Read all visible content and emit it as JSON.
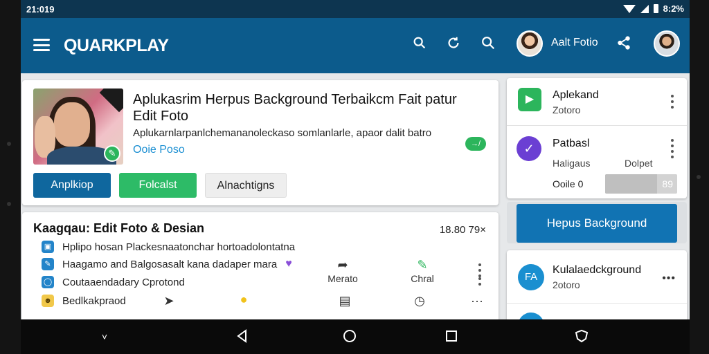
{
  "status_bar": {
    "time": "21:019",
    "battery": "8:2%"
  },
  "app_bar": {
    "title": "QUARKPLAY",
    "user_name": "Aalt Fotio"
  },
  "feature_card": {
    "title": "Aplukasrim Herpus Background Terbaikcm Fait patur Edit Foto",
    "description": "Aplukarnlarpanlchemananoleckaso somlanlarle, apaor dalit batro",
    "link": "Ooie Poso",
    "pill": "→/",
    "buttons": {
      "primary": "Anplkiop",
      "secondary": "Folcalst",
      "tertiary": "Alnachtigns"
    }
  },
  "list_card": {
    "title": "Kaagqau: Edit Foto & Desian",
    "meta": "18.80 79×",
    "rows": [
      {
        "label": "Hplipo hosan Plackesnaatonchar hortoadolontatna"
      },
      {
        "label": "Haagamo and Balgosasalt kana dadaper mara"
      },
      {
        "label": "Coutaaendadary Cprotond"
      },
      {
        "label": "Bedlkakpraod"
      }
    ],
    "mini_actions": {
      "first": "Merato",
      "second": "Chral"
    }
  },
  "right_panel": {
    "item1": {
      "title": "Aplekand",
      "subtitle": "Zotoro"
    },
    "item2": {
      "title": "Patbasl",
      "left_label": "Haligaus",
      "right_label": "Dolpet",
      "sub_label": "Ooile 0",
      "progress_value": "89",
      "progress": 0.72
    },
    "cta": "Hepus Background",
    "item3": {
      "title": "Kulalaedckground",
      "subtitle": "2otoro",
      "icon_label": "FA"
    }
  },
  "colors": {
    "app_bar": "#0c5b8c",
    "status_bar": "#0d3550",
    "primary_button": "#0f679e",
    "green_button": "#2dbb67",
    "purple": "#6b3fd3",
    "link": "#1b8fd2"
  },
  "icons": [
    "menu-icon",
    "search-alt-icon",
    "refresh-icon",
    "search-icon",
    "share-icon",
    "back-icon",
    "home-icon",
    "recents-icon",
    "assist-icon"
  ]
}
